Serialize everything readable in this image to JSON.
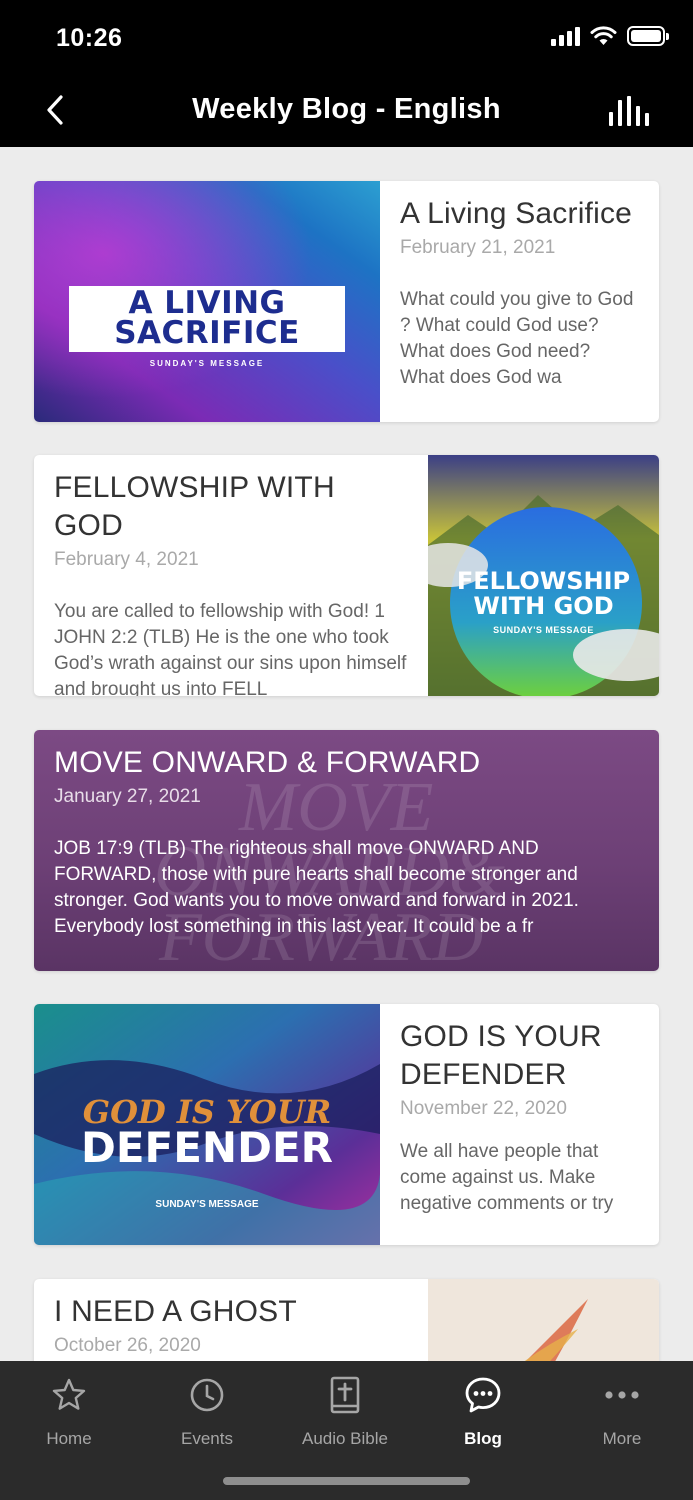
{
  "status_bar": {
    "time": "10:26"
  },
  "header": {
    "title": "Weekly Blog - English"
  },
  "posts": [
    {
      "title": "A Living Sacrifice",
      "date": "February 21, 2021",
      "excerpt": "What could you give to God ? What could God use? What does God need? What does God wa",
      "image_text": {
        "line1": "A LIVING",
        "line2": "SACRIFICE",
        "subtitle": "SUNDAY'S MESSAGE"
      }
    },
    {
      "title": "FELLOWSHIP WITH GOD",
      "date": "February 4, 2021",
      "excerpt": "You are called to fellowship with God! 1 JOHN 2:2 (TLB) He is the one who took God’s wrath against our sins upon himself and brought us into FELL",
      "image_text": {
        "line1": "FELLOWSHIP",
        "line2": "WITH GOD",
        "subtitle": "SUNDAY'S MESSAGE"
      }
    },
    {
      "title": "MOVE ONWARD & FORWARD",
      "date": "January 27, 2021",
      "excerpt": "JOB 17:9 (TLB) The righteous shall move ONWARD AND FORWARD, those with pure hearts shall become stronger and stronger. God wants you to move onward and forward in 2021. Everybody lost something in this last year. It could be a fr",
      "image_text": {
        "line1": "MOVE",
        "line2": "ONWARD&",
        "line3": "FORWARD"
      }
    },
    {
      "title": "GOD IS YOUR DEFENDER",
      "date": "November 22, 2020",
      "excerpt": "We all have people that come against us. Make negative comments or try",
      "image_text": {
        "line1": "GOD IS YOUR",
        "line2": "DEFENDER",
        "subtitle": "SUNDAY'S MESSAGE"
      }
    },
    {
      "title": "I NEED A GHOST",
      "date": "October 26, 2020",
      "excerpt": ""
    }
  ],
  "tabs": [
    {
      "label": "Home",
      "icon": "star-icon",
      "active": false
    },
    {
      "label": "Events",
      "icon": "clock-icon",
      "active": false
    },
    {
      "label": "Audio Bible",
      "icon": "bible-icon",
      "active": false
    },
    {
      "label": "Blog",
      "icon": "chat-bubble-icon",
      "active": true
    },
    {
      "label": "More",
      "icon": "more-dots-icon",
      "active": false
    }
  ],
  "colors": {
    "bar_bg": "#000000",
    "tab_bg": "#2b2b2b",
    "active_tab": "#ffffff",
    "inactive_tab": "#a6a6a6"
  }
}
